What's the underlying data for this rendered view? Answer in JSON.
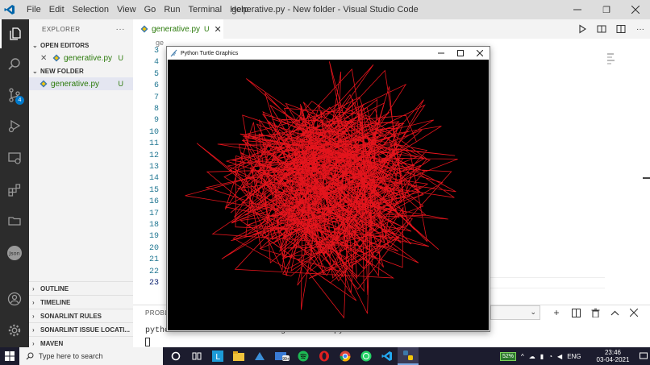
{
  "titlebar": {
    "menu": [
      "File",
      "Edit",
      "Selection",
      "View",
      "Go",
      "Run",
      "Terminal",
      "Help"
    ],
    "title": "generative.py - New folder - Visual Studio Code",
    "restore": "❐"
  },
  "activity": {
    "scm_badge": "4",
    "json_label": "Json"
  },
  "sidebar": {
    "header": "EXPLORER",
    "more": "···",
    "open_editors_title": "OPEN EDITORS",
    "open_editor_file": "generative.py",
    "open_editor_status": "U",
    "folder_title": "NEW FOLDER",
    "folder_file": "generative.py",
    "folder_file_status": "U",
    "bottom_sections": [
      "OUTLINE",
      "TIMELINE",
      "SONARLINT RULES",
      "SONARLINT ISSUE LOCATI...",
      "MAVEN"
    ]
  },
  "editor": {
    "tab_label": "generative.py",
    "tab_status": "U",
    "breadcrumb": "ge",
    "line_numbers": [
      "3",
      "4",
      "5",
      "6",
      "7",
      "8",
      "9",
      "10",
      "11",
      "12",
      "13",
      "14",
      "15",
      "16",
      "17",
      "18",
      "19",
      "20",
      "21",
      "22",
      "23"
    ],
    "current_line": "23"
  },
  "panel": {
    "tab": "PROBL",
    "terminal_line": "pythonw.exe ... s/Users/.../generative.py"
  },
  "turtle_window": {
    "title": "Python Turtle Graphics",
    "stroke_color": "#e3141c"
  },
  "taskbar": {
    "search_placeholder": "Type here to search",
    "battery": "52%",
    "language": "ENG",
    "time": "23:46",
    "date": "03-04-2021",
    "notif_badge": "99+"
  }
}
